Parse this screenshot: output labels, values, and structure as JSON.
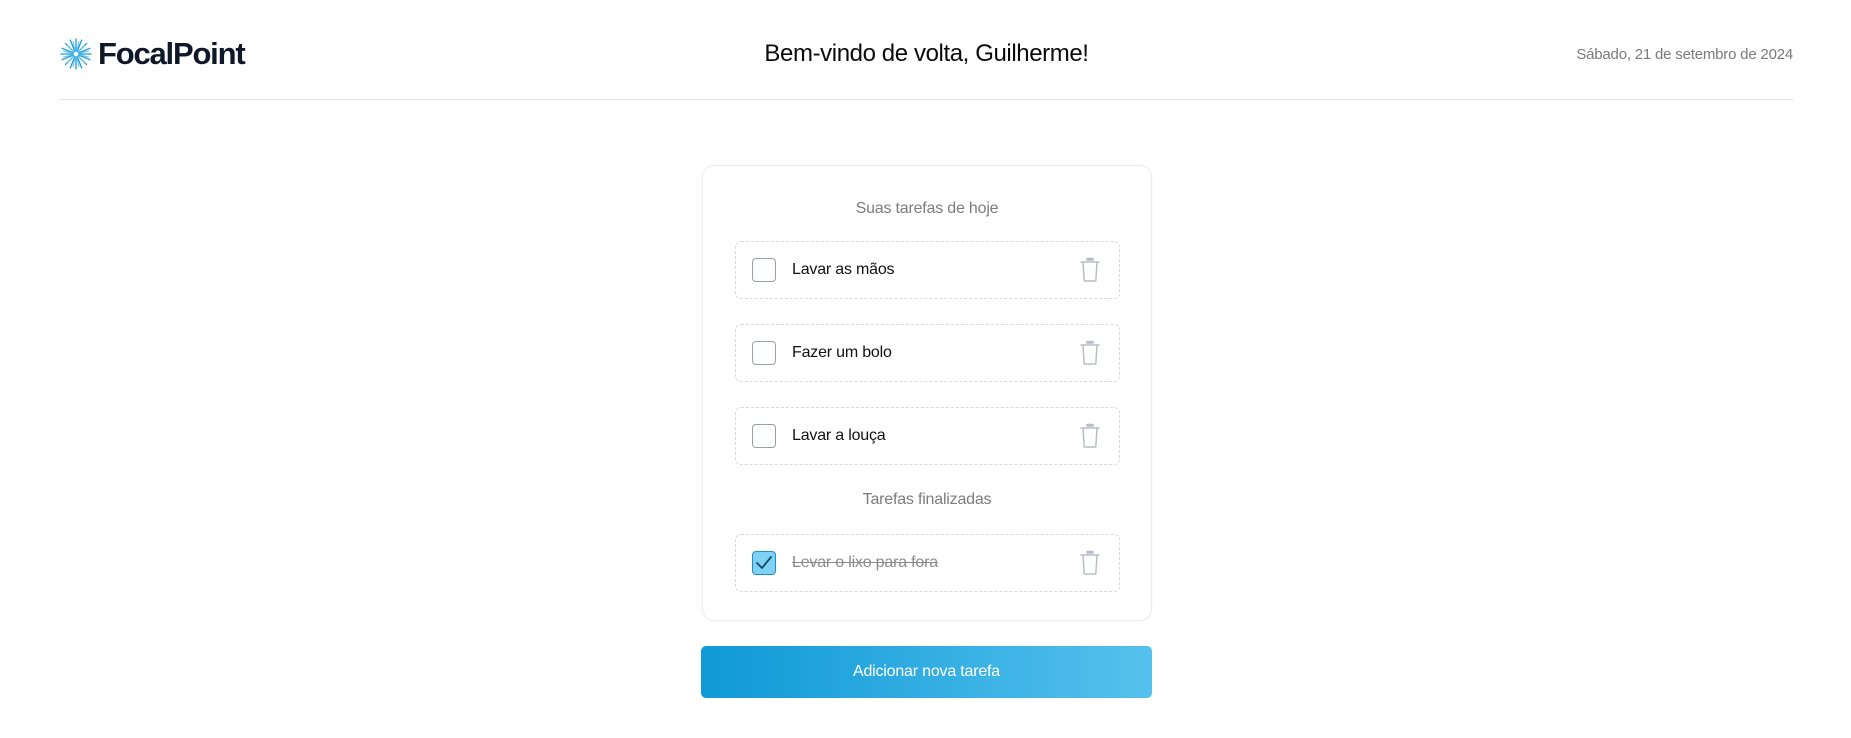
{
  "header": {
    "logo_text": "FocalPoint",
    "welcome": "Bem-vindo de volta, Guilherme!",
    "date": "Sábado, 21 de setembro de 2024"
  },
  "todo": {
    "pending_title": "Suas tarefas de hoje",
    "pending_tasks": [
      {
        "label": "Lavar as mãos",
        "done": false
      },
      {
        "label": "Fazer um bolo",
        "done": false
      },
      {
        "label": "Lavar a louça",
        "done": false
      }
    ],
    "done_title": "Tarefas finalizadas",
    "done_tasks": [
      {
        "label": "Levar o lixo para fora",
        "done": true
      }
    ]
  },
  "actions": {
    "add_label": "Adicionar nova tarefa"
  },
  "colors": {
    "accent": "#0f99d6",
    "accent_light": "#56c1ee",
    "checkbox_checked": "#7fd0f2"
  },
  "icons": {
    "logo": "starburst-logo-icon",
    "delete": "trash-icon",
    "check": "checkmark-icon"
  }
}
